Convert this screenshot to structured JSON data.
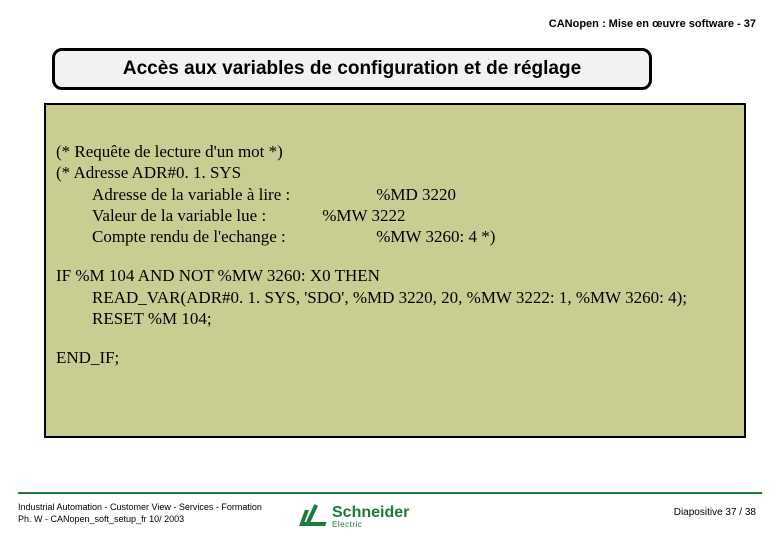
{
  "header": "CANopen : Mise en œuvre software -  37",
  "title": "Accès aux variables de configuration et de réglage",
  "code": {
    "c1": "(* Requête de lecture d'un mot *)",
    "c2": "(*   Adresse ADR#0. 1. SYS",
    "c3_label": "Adresse de la variable à lire :",
    "c3_val": "%MD 3220",
    "c4_label": "Valeur de la variable lue :",
    "c4_val": "%MW 3222",
    "c5_label": "Compte rendu de l'echange :",
    "c5_val": "%MW 3260: 4 *)",
    "if": "IF %M 104 AND NOT %MW 3260: X0 THEN",
    "read": "READ_VAR(ADR#0. 1. SYS, 'SDO', %MD 3220, 20, %MW 3222: 1, %MW 3260: 4);",
    "reset": "RESET %M 104;",
    "end": "END_IF;"
  },
  "footer": {
    "line1": "Industrial Automation -  Customer View -  Services -  Formation",
    "line2": "Ph. W -  CANopen_soft_setup_fr  10/ 2003",
    "right": "Diapositive 37 / 38",
    "logo_main": "Schneider",
    "logo_sub": "Electric"
  }
}
